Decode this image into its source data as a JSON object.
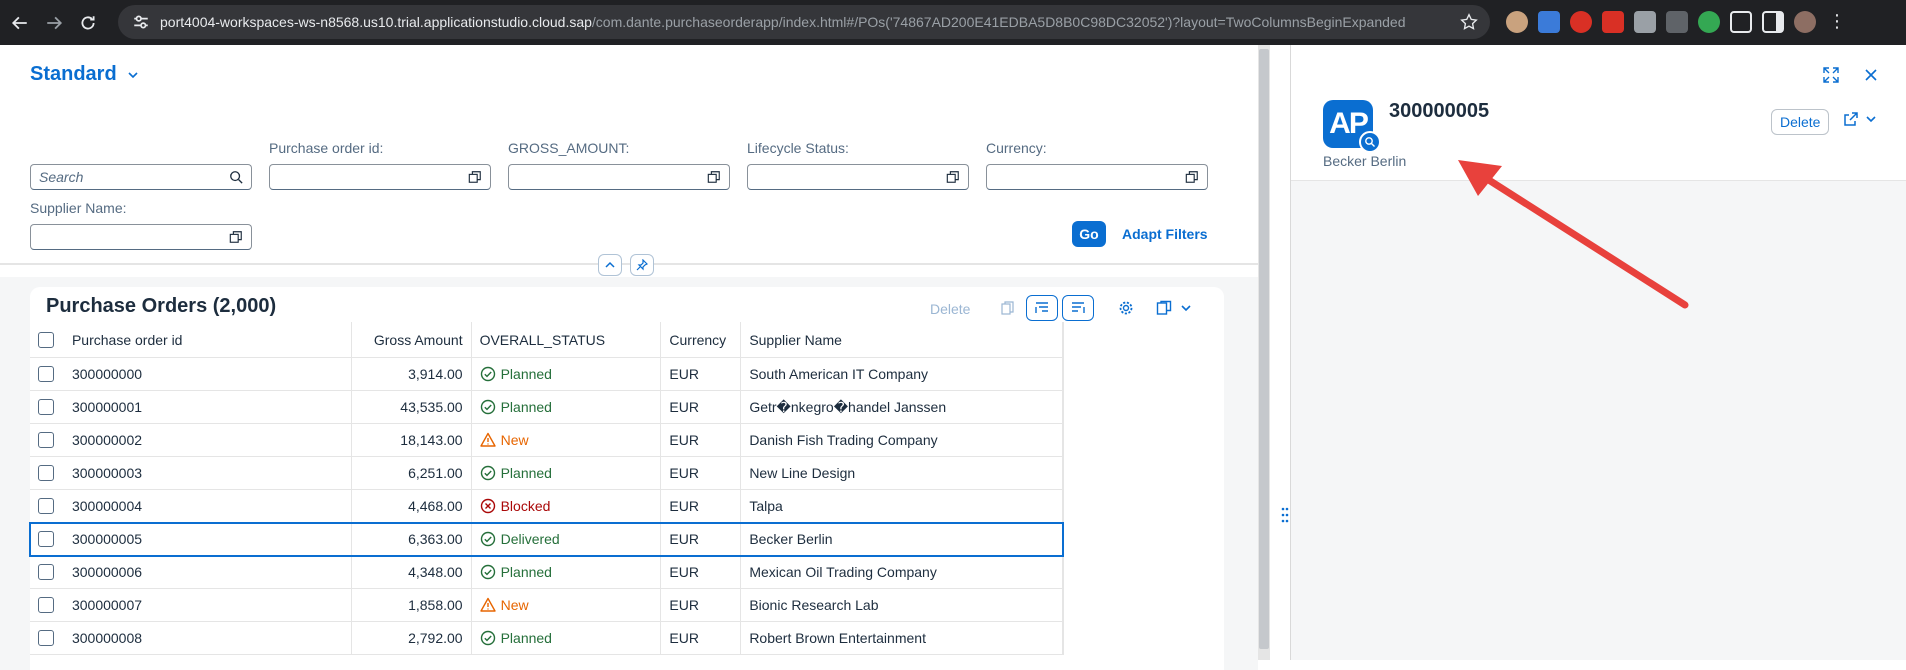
{
  "browser": {
    "url_host": "port4004-workspaces-ws-n8568.us10.trial.applicationstudio.cloud.sap",
    "url_path": "/com.dante.purchaseorderapp/index.html#/POs('74867AD200E41EDBA5D8B0C98DC32052')?layout=TwoColumnsBeginExpanded"
  },
  "variant": {
    "label": "Standard"
  },
  "filters": {
    "search_placeholder": "Search",
    "po_id_label": "Purchase order id:",
    "gross_label": "GROSS_AMOUNT:",
    "lifecycle_label": "Lifecycle Status:",
    "currency_label": "Currency:",
    "supplier_label": "Supplier Name:",
    "go_label": "Go",
    "adapt_label": "Adapt Filters"
  },
  "table": {
    "title": "Purchase Orders (2,000)",
    "delete_label": "Delete",
    "columns": [
      "Purchase order id",
      "Gross Amount",
      "OVERALL_STATUS",
      "Currency",
      "Supplier Name"
    ],
    "rows": [
      {
        "id": "300000000",
        "amount": "3,914.00",
        "status": "Planned",
        "currency": "EUR",
        "supplier": "South American IT Company"
      },
      {
        "id": "300000001",
        "amount": "43,535.00",
        "status": "Planned",
        "currency": "EUR",
        "supplier": "Getr�nkegro�handel Janssen"
      },
      {
        "id": "300000002",
        "amount": "18,143.00",
        "status": "New",
        "currency": "EUR",
        "supplier": "Danish Fish Trading Company"
      },
      {
        "id": "300000003",
        "amount": "6,251.00",
        "status": "Planned",
        "currency": "EUR",
        "supplier": "New Line Design"
      },
      {
        "id": "300000004",
        "amount": "4,468.00",
        "status": "Blocked",
        "currency": "EUR",
        "supplier": "Talpa"
      },
      {
        "id": "300000005",
        "amount": "6,363.00",
        "status": "Delivered",
        "currency": "EUR",
        "supplier": "Becker Berlin"
      },
      {
        "id": "300000006",
        "amount": "4,348.00",
        "status": "Planned",
        "currency": "EUR",
        "supplier": "Mexican Oil Trading Company"
      },
      {
        "id": "300000007",
        "amount": "1,858.00",
        "status": "New",
        "currency": "EUR",
        "supplier": "Bionic Research Lab"
      },
      {
        "id": "300000008",
        "amount": "2,792.00",
        "status": "Planned",
        "currency": "EUR",
        "supplier": "Robert Brown Entertainment"
      }
    ]
  },
  "detail": {
    "avatar_initials": "AP",
    "title": "300000005",
    "subtitle": "Becker Berlin",
    "delete_label": "Delete"
  },
  "colors": {
    "brand_blue": "#0a6ed1",
    "planned": "#256f3a",
    "new": "#e76500",
    "blocked": "#aa0808",
    "annotation_arrow": "#e8413c"
  }
}
